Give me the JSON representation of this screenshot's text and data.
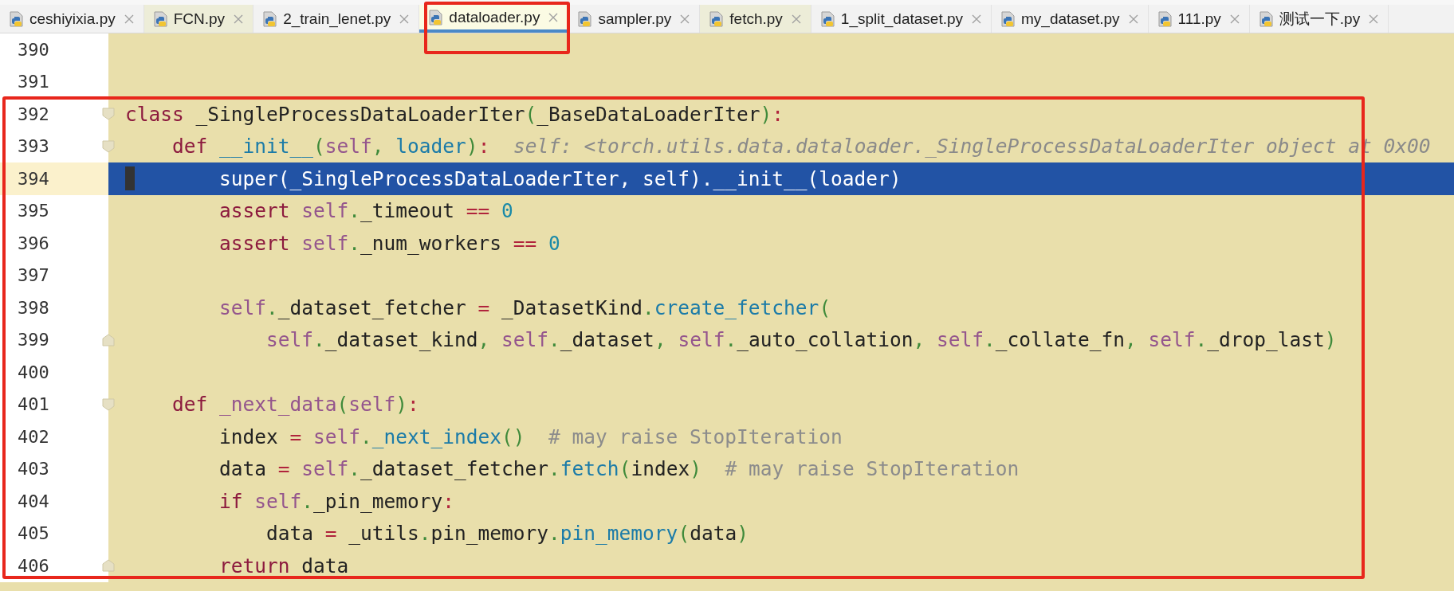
{
  "tabs": [
    {
      "label": "ceshiyixia.py",
      "selected": false,
      "color": "#f2f2f2"
    },
    {
      "label": "FCN.py",
      "selected": false,
      "color": "#ededd8"
    },
    {
      "label": "2_train_lenet.py",
      "selected": false,
      "color": "#f2f2f2"
    },
    {
      "label": "dataloader.py",
      "selected": true,
      "color": "#fbfbe4"
    },
    {
      "label": "sampler.py",
      "selected": false,
      "color": "#f2f2f2"
    },
    {
      "label": "fetch.py",
      "selected": false,
      "color": "#ededd8"
    },
    {
      "label": "1_split_dataset.py",
      "selected": false,
      "color": "#f2f2f2"
    },
    {
      "label": "my_dataset.py",
      "selected": false,
      "color": "#f2f2f2"
    },
    {
      "label": "111.py",
      "selected": false,
      "color": "#f2f2f2"
    },
    {
      "label": "测试一下.py",
      "selected": false,
      "color": "#f2f2f2"
    }
  ],
  "editor": {
    "lines": [
      {
        "number": "390",
        "selected": false
      },
      {
        "number": "391",
        "selected": false
      },
      {
        "number": "392",
        "selected": false,
        "fold_start": true,
        "tokens": [
          {
            "text": "class",
            "kind": "kw"
          },
          {
            "text": " _SingleProcessDataLoaderIter",
            "kind": "plain"
          },
          {
            "text": "(",
            "kind": "punct"
          },
          {
            "text": "_BaseDataLoaderIter",
            "kind": "plain"
          },
          {
            "text": ")",
            "kind": "punct"
          },
          {
            "text": ":",
            "kind": "op"
          }
        ]
      },
      {
        "number": "393",
        "selected": false,
        "fold_start": true,
        "tokens": [
          {
            "text": "    def ",
            "kind": "kw"
          },
          {
            "text": "__init__",
            "kind": "call"
          },
          {
            "text": "(",
            "kind": "punct"
          },
          {
            "text": "self",
            "kind": "self"
          },
          {
            "text": ", ",
            "kind": "punct"
          },
          {
            "text": "loader",
            "kind": "call"
          },
          {
            "text": ")",
            "kind": "punct"
          },
          {
            "text": ":",
            "kind": "op"
          },
          {
            "text": "  self: <torch.utils.data.dataloader._SingleProcessDataLoaderIter object at 0x00",
            "kind": "hint"
          }
        ]
      },
      {
        "number": "394",
        "selected": true,
        "tokens": [
          {
            "text": "        super(_SingleProcessDataLoaderIter, self).__init__(loader)",
            "kind": "plain"
          }
        ]
      },
      {
        "number": "395",
        "selected": false,
        "tokens": [
          {
            "text": "        assert",
            "kind": "kw"
          },
          {
            "text": " self",
            "kind": "self"
          },
          {
            "text": ".",
            "kind": "punct"
          },
          {
            "text": "_timeout ",
            "kind": "plain"
          },
          {
            "text": "== ",
            "kind": "op"
          },
          {
            "text": "0",
            "kind": "num"
          }
        ]
      },
      {
        "number": "396",
        "selected": false,
        "tokens": [
          {
            "text": "        assert",
            "kind": "kw"
          },
          {
            "text": " self",
            "kind": "self"
          },
          {
            "text": ".",
            "kind": "punct"
          },
          {
            "text": "_num_workers ",
            "kind": "plain"
          },
          {
            "text": "== ",
            "kind": "op"
          },
          {
            "text": "0",
            "kind": "num"
          }
        ]
      },
      {
        "number": "397",
        "selected": false
      },
      {
        "number": "398",
        "selected": false,
        "tokens": [
          {
            "text": "        self",
            "kind": "self"
          },
          {
            "text": ".",
            "kind": "punct"
          },
          {
            "text": "_dataset_fetcher ",
            "kind": "plain"
          },
          {
            "text": "=",
            "kind": "op"
          },
          {
            "text": " _DatasetKind",
            "kind": "plain"
          },
          {
            "text": ".",
            "kind": "punct"
          },
          {
            "text": "create_fetcher",
            "kind": "call"
          },
          {
            "text": "(",
            "kind": "punct"
          }
        ]
      },
      {
        "number": "399",
        "selected": false,
        "fold_end": true,
        "tokens": [
          {
            "text": "            self",
            "kind": "self"
          },
          {
            "text": ".",
            "kind": "punct"
          },
          {
            "text": "_dataset_kind",
            "kind": "plain"
          },
          {
            "text": ", ",
            "kind": "punct"
          },
          {
            "text": "self",
            "kind": "self"
          },
          {
            "text": ".",
            "kind": "punct"
          },
          {
            "text": "_dataset",
            "kind": "plain"
          },
          {
            "text": ", ",
            "kind": "punct"
          },
          {
            "text": "self",
            "kind": "self"
          },
          {
            "text": ".",
            "kind": "punct"
          },
          {
            "text": "_auto_collation",
            "kind": "plain"
          },
          {
            "text": ", ",
            "kind": "punct"
          },
          {
            "text": "self",
            "kind": "self"
          },
          {
            "text": ".",
            "kind": "punct"
          },
          {
            "text": "_collate_fn",
            "kind": "plain"
          },
          {
            "text": ", ",
            "kind": "punct"
          },
          {
            "text": "self",
            "kind": "self"
          },
          {
            "text": ".",
            "kind": "punct"
          },
          {
            "text": "_drop_last",
            "kind": "plain"
          },
          {
            "text": ")",
            "kind": "punct"
          }
        ]
      },
      {
        "number": "400",
        "selected": false
      },
      {
        "number": "401",
        "selected": false,
        "fold_start": true,
        "tokens": [
          {
            "text": "    def ",
            "kind": "kw"
          },
          {
            "text": "_next_data",
            "kind": "self"
          },
          {
            "text": "(",
            "kind": "punct"
          },
          {
            "text": "self",
            "kind": "self"
          },
          {
            "text": ")",
            "kind": "punct"
          },
          {
            "text": ":",
            "kind": "op"
          }
        ]
      },
      {
        "number": "402",
        "selected": false,
        "tokens": [
          {
            "text": "        index ",
            "kind": "plain"
          },
          {
            "text": "=",
            "kind": "op"
          },
          {
            "text": " self",
            "kind": "self"
          },
          {
            "text": ".",
            "kind": "punct"
          },
          {
            "text": "_next_index",
            "kind": "call"
          },
          {
            "text": "()",
            "kind": "punct"
          },
          {
            "text": "  # may raise StopIteration",
            "kind": "comment"
          }
        ]
      },
      {
        "number": "403",
        "selected": false,
        "tokens": [
          {
            "text": "        data ",
            "kind": "plain"
          },
          {
            "text": "=",
            "kind": "op"
          },
          {
            "text": " self",
            "kind": "self"
          },
          {
            "text": ".",
            "kind": "punct"
          },
          {
            "text": "_dataset_fetcher",
            "kind": "plain"
          },
          {
            "text": ".",
            "kind": "punct"
          },
          {
            "text": "fetch",
            "kind": "call"
          },
          {
            "text": "(",
            "kind": "punct"
          },
          {
            "text": "index",
            "kind": "plain"
          },
          {
            "text": ")",
            "kind": "punct"
          },
          {
            "text": "  # may raise StopIteration",
            "kind": "comment"
          }
        ]
      },
      {
        "number": "404",
        "selected": false,
        "tokens": [
          {
            "text": "        if",
            "kind": "kw"
          },
          {
            "text": " self",
            "kind": "self"
          },
          {
            "text": ".",
            "kind": "punct"
          },
          {
            "text": "_pin_memory",
            "kind": "plain"
          },
          {
            "text": ":",
            "kind": "op"
          }
        ]
      },
      {
        "number": "405",
        "selected": false,
        "tokens": [
          {
            "text": "            data ",
            "kind": "plain"
          },
          {
            "text": "=",
            "kind": "op"
          },
          {
            "text": " _utils",
            "kind": "plain"
          },
          {
            "text": ".",
            "kind": "punct"
          },
          {
            "text": "pin_memory",
            "kind": "plain"
          },
          {
            "text": ".",
            "kind": "punct"
          },
          {
            "text": "pin_memory",
            "kind": "call"
          },
          {
            "text": "(",
            "kind": "punct"
          },
          {
            "text": "data",
            "kind": "plain"
          },
          {
            "text": ")",
            "kind": "punct"
          }
        ]
      },
      {
        "number": "406",
        "selected": false,
        "fold_end": true,
        "tokens": [
          {
            "text": "        return",
            "kind": "kw"
          },
          {
            "text": " data",
            "kind": "plain"
          }
        ]
      }
    ]
  }
}
